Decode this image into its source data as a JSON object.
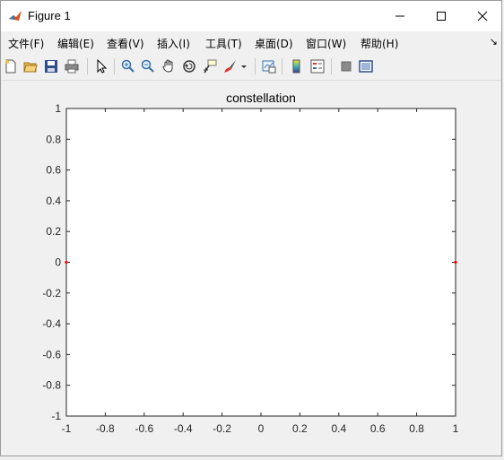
{
  "window": {
    "title": "Figure 1",
    "controls": {
      "minimize": "minimize",
      "maximize": "maximize",
      "close": "close"
    }
  },
  "menu": {
    "items": [
      "文件(F)",
      "编辑(E)",
      "查看(V)",
      "插入(I)",
      "工具(T)",
      "桌面(D)",
      "窗口(W)",
      "帮助(H)"
    ],
    "overflow_arrow": "↘"
  },
  "toolbar": {
    "icons": [
      "new-figure-icon",
      "open-file-icon",
      "save-icon",
      "print-icon",
      "pointer-icon",
      "zoom-in-icon",
      "zoom-out-icon",
      "pan-icon",
      "rotate-3d-icon",
      "data-cursor-icon",
      "brush-icon",
      "brush-dropdown-icon",
      "link-plot-icon",
      "colorbar-icon",
      "legend-icon",
      "hide-plot-tools-icon",
      "show-plot-tools-icon"
    ]
  },
  "colors": {
    "marker": "#ff0000",
    "axes_bg": "#ffffff",
    "figure_bg": "#f0f0f0"
  },
  "chart_data": {
    "type": "scatter",
    "title": "constellation",
    "xlabel": "",
    "ylabel": "",
    "xlim": [
      -1,
      1
    ],
    "ylim": [
      -1,
      1
    ],
    "xticks": [
      "-1",
      "-0.8",
      "-0.6",
      "-0.4",
      "-0.2",
      "0",
      "0.2",
      "0.4",
      "0.6",
      "0.8",
      "1"
    ],
    "yticks": [
      "1",
      "0.8",
      "0.6",
      "0.4",
      "0.2",
      "0",
      "-0.2",
      "-0.4",
      "-0.6",
      "-0.8",
      "-1"
    ],
    "grid": false,
    "series": [
      {
        "x": [
          -1,
          1
        ],
        "y": [
          0,
          0
        ],
        "color": "#ff0000",
        "marker": "dot"
      }
    ]
  }
}
